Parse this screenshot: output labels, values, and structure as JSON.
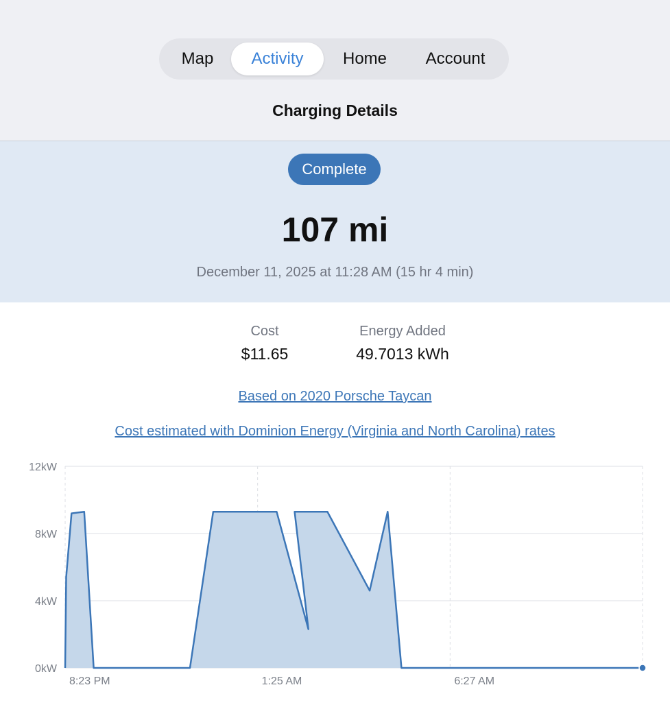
{
  "nav": {
    "tabs": [
      {
        "label": "Map",
        "active": false
      },
      {
        "label": "Activity",
        "active": true
      },
      {
        "label": "Home",
        "active": false
      },
      {
        "label": "Account",
        "active": false
      }
    ]
  },
  "page_title": "Charging Details",
  "hero": {
    "status": "Complete",
    "distance": "107 mi",
    "datetime": "December 11, 2025 at 11:28 AM (15 hr 4 min)"
  },
  "stats": {
    "cost_label": "Cost",
    "cost_value": "$11.65",
    "energy_label": "Energy Added",
    "energy_value": "49.7013 kWh"
  },
  "links": {
    "vehicle": "Based on 2020 Porsche Taycan",
    "rates": "Cost estimated with Dominion Energy (Virginia and North Carolina) rates"
  },
  "colors": {
    "accent": "#3a82d8",
    "badge": "#3c76b7",
    "hero_bg": "#e0e9f4",
    "line": "#3c76b7",
    "fill": "#c5d7ea"
  },
  "chart_data": {
    "type": "area",
    "title": "",
    "xlabel": "",
    "ylabel": "",
    "ylim": [
      0,
      12
    ],
    "yticks": [
      0,
      4,
      8,
      12
    ],
    "ytick_labels": [
      "0kW",
      "4kW",
      "8kW",
      "12kW"
    ],
    "xticks": [
      0,
      182,
      364
    ],
    "xtick_labels": [
      "8:23 PM",
      "1:25 AM",
      "6:27 AM"
    ],
    "xlim": [
      0,
      546
    ],
    "grid": true,
    "series": [
      {
        "x": [
          0,
          1,
          6,
          18,
          27,
          75,
          118,
          140,
          200,
          230,
          217,
          248,
          288,
          305,
          318,
          325,
          363,
          546
        ],
        "y": [
          0,
          5.4,
          9.2,
          9.3,
          0,
          0,
          0,
          9.3,
          9.3,
          2.3,
          9.3,
          9.3,
          4.6,
          9.3,
          0,
          0,
          0,
          0
        ]
      }
    ]
  }
}
